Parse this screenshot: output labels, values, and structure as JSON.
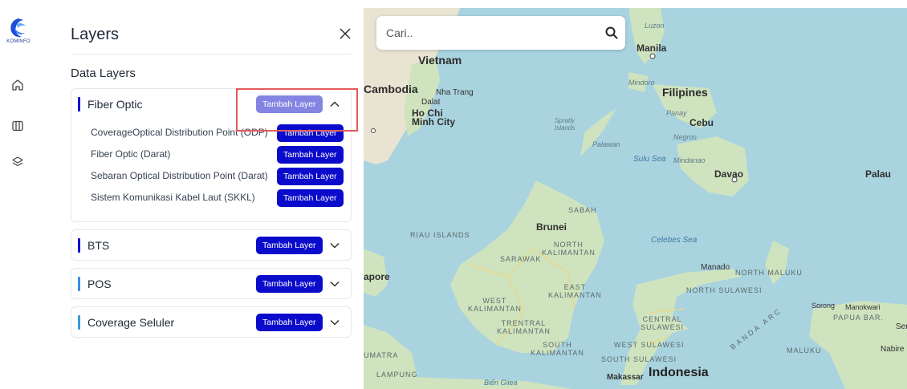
{
  "logo": {
    "text": "KOMINFO"
  },
  "rail": {
    "icons": [
      "home-icon",
      "map-icon",
      "layers-icon"
    ]
  },
  "panel": {
    "title": "Layers",
    "section_title": "Data Layers",
    "add_label": "Tambah Layer",
    "groups": [
      {
        "name": "Fiber Optic",
        "accent": "#0b0bcc",
        "expanded": true,
        "items": [
          "CoverageOptical Distribution Point (ODP)",
          "Fiber Optic (Darat)",
          "Sebaran Optical Distribution Point (Darat)",
          "Sistem Komunikasi Kabel Laut (SKKL)"
        ]
      },
      {
        "name": "BTS",
        "accent": "#0b0bcc",
        "expanded": false
      },
      {
        "name": "POS",
        "accent": "#3b8ee0",
        "expanded": false
      },
      {
        "name": "Coverage Seluler",
        "accent": "#3b9ad9",
        "expanded": false
      }
    ]
  },
  "map": {
    "search_placeholder": "Cari..",
    "labels": {
      "vietnam": "Vietnam",
      "cambodia": "Cambodia",
      "nha_trang": "Nha Trang",
      "dalat": "Dalat",
      "hcmc": "Ho Chi\nMinh City",
      "spratly": "Spratly\nIslands",
      "luzon": "Luzon",
      "manila": "Manila",
      "mindoro": "Mindoro",
      "filipines": "Filipines",
      "panay": "Panay",
      "cebu": "Cebu",
      "negros": "Negros",
      "palawan": "Palawan",
      "sulu_sea": "Sulu Sea",
      "mindanao": "Mindanao",
      "davao": "Davao",
      "palau": "Palau",
      "sabah": "SABAH",
      "brunei": "Brunei",
      "riau": "RIAU ISLANDS",
      "sarawak": "SARAWAK",
      "north_kalimantan": "NORTH\nKALIMANTAN",
      "celebes_sea": "Celebes Sea",
      "manado": "Manado",
      "north_maluku": "NORTH MALUKU",
      "apore": "apore",
      "east_kalimantan": "EAST\nKALIMANTAN",
      "north_sulawesi": "NORTH SULAWESI",
      "west_kalimantan": "WEST\nKALIMANTAN",
      "central_kalimantan": "TRENTRAL\nKALIMANTAN",
      "central_sulawesi": "CENTRAL\nSULAWESI",
      "sorong": "Sorong",
      "manokwari": "Manokwari",
      "papua_barat": "PAPUA BAR.",
      "ser": "Ser",
      "south_kalimantan": "SOUTH\nKALIMANTAN",
      "west_sulawesi": "WEST SULAWESI",
      "south_sulawesi": "SOUTH SULAWESI",
      "maluku": "MALUKU",
      "nabire": "Nabire",
      "sumatra": "UMATRA",
      "lampung": "LAMPUNG",
      "bien_giea": "Biển Giiea",
      "makassar": "Makassar",
      "indonesia": "Indonesia",
      "banda_arc": "BANDA ARC"
    }
  }
}
